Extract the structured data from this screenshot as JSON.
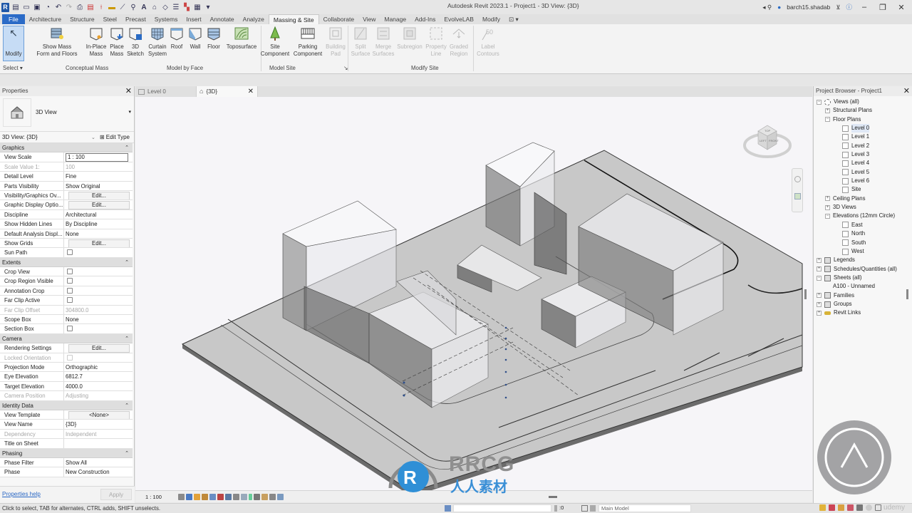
{
  "app": {
    "title": "Autodesk Revit 2023.1 - Project1 - 3D View: {3D}",
    "user": "barch15.shadab",
    "qat_icons": [
      "revit-logo-icon",
      "open-icon",
      "open-folder-icon",
      "save-icon",
      "sync-icon",
      "undo-icon",
      "redo-icon",
      "print-icon",
      "pdf-icon",
      "measure-icon",
      "dimension-icon",
      "tag-icon",
      "text-icon",
      "3d-view-icon",
      "section-icon",
      "thin-lines-icon",
      "close-hidden-icon",
      "switch-windows-icon"
    ],
    "window_controls": {
      "minimize": "‒",
      "restore": "❐",
      "close": "✕"
    }
  },
  "ribbon": {
    "tabs": [
      "File",
      "Architecture",
      "Structure",
      "Steel",
      "Precast",
      "Systems",
      "Insert",
      "Annotate",
      "Analyze",
      "Massing & Site",
      "Collaborate",
      "View",
      "Manage",
      "Add-Ins",
      "EvolveLAB",
      "Modify"
    ],
    "active_tab": "Massing & Site",
    "buttons": [
      {
        "id": "modify",
        "label": "Modify",
        "enabled": true
      },
      {
        "id": "show-mass",
        "label": "Show Mass\nForm and Floors",
        "enabled": true
      },
      {
        "id": "in-place-mass",
        "label": "In-Place\nMass",
        "enabled": true
      },
      {
        "id": "place-mass",
        "label": "Place\nMass",
        "enabled": true
      },
      {
        "id": "3d-sketch",
        "label": "3D\nSketch",
        "enabled": true
      },
      {
        "id": "curtain-system",
        "label": "Curtain\nSystem",
        "enabled": true
      },
      {
        "id": "roof",
        "label": "Roof",
        "enabled": true
      },
      {
        "id": "wall",
        "label": "Wall",
        "enabled": true
      },
      {
        "id": "floor",
        "label": "Floor",
        "enabled": true
      },
      {
        "id": "toposurface",
        "label": "Toposurface",
        "enabled": true
      },
      {
        "id": "site-component",
        "label": "Site\nComponent",
        "enabled": true
      },
      {
        "id": "parking-component",
        "label": "Parking\nComponent",
        "enabled": true
      },
      {
        "id": "building-pad",
        "label": "Building\nPad",
        "enabled": false
      },
      {
        "id": "split-surface",
        "label": "Split\nSurface",
        "enabled": false
      },
      {
        "id": "merge-surfaces",
        "label": "Merge\nSurfaces",
        "enabled": false
      },
      {
        "id": "subregion",
        "label": "Subregion",
        "enabled": false
      },
      {
        "id": "property-line",
        "label": "Property\nLine",
        "enabled": false
      },
      {
        "id": "graded-region",
        "label": "Graded\nRegion",
        "enabled": false
      },
      {
        "id": "label-contours",
        "label": "Label\nContours",
        "enabled": false
      }
    ],
    "panels": {
      "select": "Select ▾",
      "conceptual_mass": "Conceptual Mass",
      "model_by_face": "Model by Face",
      "model_site": "Model Site",
      "model_site_launcher": "↘",
      "modify_site": "Modify Site"
    }
  },
  "properties": {
    "title": "Properties",
    "type_name": "3D View",
    "instance": "3D View: {3D}",
    "edit_type": "Edit Type",
    "groups": [
      {
        "name": "Graphics",
        "rows": [
          {
            "name": "View Scale",
            "value": "1 : 100",
            "kind": "boxed"
          },
          {
            "name": "Scale Value    1:",
            "value": "100",
            "kind": "dim"
          },
          {
            "name": "Detail Level",
            "value": "Fine"
          },
          {
            "name": "Parts Visibility",
            "value": "Show Original"
          },
          {
            "name": "Visibility/Graphics Ov...",
            "value": "Edit...",
            "kind": "button"
          },
          {
            "name": "Graphic Display Optio...",
            "value": "Edit...",
            "kind": "button"
          },
          {
            "name": "Discipline",
            "value": "Architectural"
          },
          {
            "name": "Show Hidden Lines",
            "value": "By Discipline"
          },
          {
            "name": "Default Analysis Displ...",
            "value": "None"
          },
          {
            "name": "Show Grids",
            "value": "Edit...",
            "kind": "button"
          },
          {
            "name": "Sun Path",
            "value": "",
            "kind": "checkbox",
            "checked": false
          }
        ]
      },
      {
        "name": "Extents",
        "rows": [
          {
            "name": "Crop View",
            "value": "",
            "kind": "checkbox",
            "checked": false
          },
          {
            "name": "Crop Region Visible",
            "value": "",
            "kind": "checkbox",
            "checked": false
          },
          {
            "name": "Annotation Crop",
            "value": "",
            "kind": "checkbox",
            "checked": false
          },
          {
            "name": "Far Clip Active",
            "value": "",
            "kind": "checkbox",
            "checked": false
          },
          {
            "name": "Far Clip Offset",
            "value": "304800.0",
            "kind": "dim"
          },
          {
            "name": "Scope Box",
            "value": "None"
          },
          {
            "name": "Section Box",
            "value": "",
            "kind": "checkbox",
            "checked": false
          }
        ]
      },
      {
        "name": "Camera",
        "rows": [
          {
            "name": "Rendering Settings",
            "value": "Edit...",
            "kind": "button"
          },
          {
            "name": "Locked Orientation",
            "value": "",
            "kind": "dimcheckbox"
          },
          {
            "name": "Projection Mode",
            "value": "Orthographic"
          },
          {
            "name": "Eye Elevation",
            "value": "6812.7"
          },
          {
            "name": "Target Elevation",
            "value": "4000.0"
          },
          {
            "name": "Camera Position",
            "value": "Adjusting",
            "kind": "dim"
          }
        ]
      },
      {
        "name": "Identity Data",
        "rows": [
          {
            "name": "View Template",
            "value": "<None>",
            "kind": "button"
          },
          {
            "name": "View Name",
            "value": "{3D}"
          },
          {
            "name": "Dependency",
            "value": "Independent",
            "kind": "dim"
          },
          {
            "name": "Title on Sheet",
            "value": ""
          }
        ]
      },
      {
        "name": "Phasing",
        "rows": [
          {
            "name": "Phase Filter",
            "value": "Show All"
          },
          {
            "name": "Phase",
            "value": "New Construction"
          }
        ]
      }
    ],
    "help_link": "Properties help",
    "apply": "Apply"
  },
  "view_tabs": [
    {
      "label": "Level 0",
      "active": false
    },
    {
      "label": "{3D}",
      "active": true
    }
  ],
  "viewcube": {
    "top": "TOP",
    "left": "LEFT",
    "front": "FRONT"
  },
  "view_control_bar": {
    "scale": "1 : 100"
  },
  "project_browser": {
    "title": "Project Browser - Project1",
    "nodes": [
      {
        "label": "Views (all)",
        "level": 0,
        "expander": "−",
        "icon": "views"
      },
      {
        "label": "Structural Plans",
        "level": 1,
        "expander": "+"
      },
      {
        "label": "Floor Plans",
        "level": 1,
        "expander": "−"
      },
      {
        "label": "Level 0",
        "level": 2,
        "view": true,
        "selected": true
      },
      {
        "label": "Level 1",
        "level": 2,
        "view": true
      },
      {
        "label": "Level 2",
        "level": 2,
        "view": true
      },
      {
        "label": "Level 3",
        "level": 2,
        "view": true
      },
      {
        "label": "Level 4",
        "level": 2,
        "view": true
      },
      {
        "label": "Level 5",
        "level": 2,
        "view": true
      },
      {
        "label": "Level 6",
        "level": 2,
        "view": true
      },
      {
        "label": "Site",
        "level": 2,
        "view": true
      },
      {
        "label": "Ceiling Plans",
        "level": 1,
        "expander": "+"
      },
      {
        "label": "3D Views",
        "level": 1,
        "expander": "+"
      },
      {
        "label": "Elevations (12mm Circle)",
        "level": 1,
        "expander": "−"
      },
      {
        "label": "East",
        "level": 2,
        "view": true
      },
      {
        "label": "North",
        "level": 2,
        "view": true
      },
      {
        "label": "South",
        "level": 2,
        "view": true
      },
      {
        "label": "West",
        "level": 2,
        "view": true
      },
      {
        "label": "Legends",
        "level": 0,
        "expander": "+",
        "icon": "legend"
      },
      {
        "label": "Schedules/Quantities (all)",
        "level": 0,
        "expander": "+",
        "icon": "schedule"
      },
      {
        "label": "Sheets (all)",
        "level": 0,
        "expander": "−",
        "icon": "sheet"
      },
      {
        "label": "A100 - Unnamed",
        "level": 1
      },
      {
        "label": "Families",
        "level": 0,
        "expander": "+",
        "icon": "family"
      },
      {
        "label": "Groups",
        "level": 0,
        "expander": "+",
        "icon": "group"
      },
      {
        "label": "Revit Links",
        "level": 0,
        "expander": "+",
        "icon": "link"
      }
    ]
  },
  "status": {
    "text": "Click to select, TAB for alternates, CTRL adds, SHIFT unselects.",
    "selection_count": ":0",
    "active_model": "Main Model",
    "filter_count": "0"
  },
  "watermark": {
    "brand": "RRCG",
    "brand_cn": "人人素材",
    "site": "udemy"
  }
}
